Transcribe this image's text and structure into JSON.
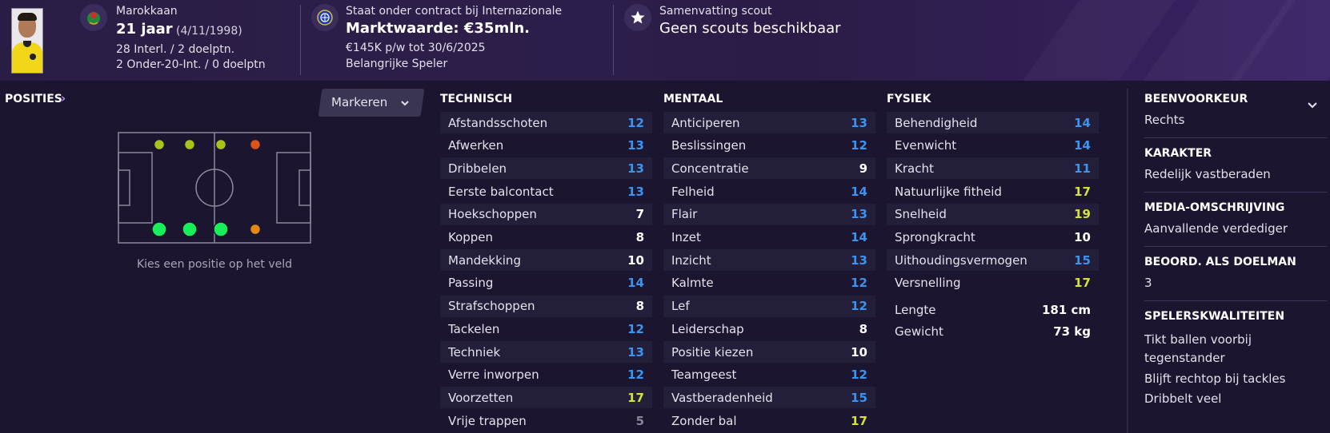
{
  "header": {
    "nationality": "Marokkaan",
    "age": "21 jaar",
    "birthdate": "(4/11/1998)",
    "caps_line": "28 Interl. / 2 doelptn.",
    "u20_line": "2 Onder-20-Int. / 0 doelptn",
    "contract_line": "Staat onder contract bij Internazionale",
    "value": "Marktwaarde: €35mln.",
    "wage_line": "€145K p/w tot 30/6/2025",
    "status": "Belangrijke Speler",
    "scout_title": "Samenvatting scout",
    "scout_value": "Geen scouts beschikbaar",
    "icons": [
      "player-photo",
      "morocco-flag-icon",
      "inter-club-icon",
      "star-icon"
    ]
  },
  "positions": {
    "title": "POSITIES",
    "chevron": "›",
    "mark_button": "Markeren",
    "caption": "Kies een positie op het veld",
    "dots": [
      {
        "row": "top",
        "col": 0,
        "color": "#a8c41c",
        "size": "small"
      },
      {
        "row": "top",
        "col": 1,
        "color": "#a8c41c",
        "size": "small"
      },
      {
        "row": "top",
        "col": 2,
        "color": "#a8c41c",
        "size": "small"
      },
      {
        "row": "top",
        "col": 3,
        "color": "#d8541a",
        "size": "small"
      },
      {
        "row": "bottom",
        "col": 0,
        "color": "#17f05a",
        "size": "large"
      },
      {
        "row": "bottom",
        "col": 1,
        "color": "#17f05a",
        "size": "large"
      },
      {
        "row": "bottom",
        "col": 2,
        "color": "#17f05a",
        "size": "large"
      },
      {
        "row": "bottom",
        "col": 3,
        "color": "#e48a14",
        "size": "small"
      }
    ]
  },
  "columns": [
    {
      "title": "TECHNISCH",
      "attrs": [
        {
          "name": "Afstandsschoten",
          "value": "12",
          "tone": "blue"
        },
        {
          "name": "Afwerken",
          "value": "13",
          "tone": "blue"
        },
        {
          "name": "Dribbelen",
          "value": "13",
          "tone": "blue"
        },
        {
          "name": "Eerste balcontact",
          "value": "13",
          "tone": "blue"
        },
        {
          "name": "Hoekschoppen",
          "value": "7",
          "tone": "white"
        },
        {
          "name": "Koppen",
          "value": "8",
          "tone": "white"
        },
        {
          "name": "Mandekking",
          "value": "10",
          "tone": "white"
        },
        {
          "name": "Passing",
          "value": "14",
          "tone": "blue"
        },
        {
          "name": "Strafschoppen",
          "value": "8",
          "tone": "white"
        },
        {
          "name": "Tackelen",
          "value": "12",
          "tone": "blue"
        },
        {
          "name": "Techniek",
          "value": "13",
          "tone": "blue"
        },
        {
          "name": "Verre inworpen",
          "value": "12",
          "tone": "blue"
        },
        {
          "name": "Voorzetten",
          "value": "17",
          "tone": "yellow"
        },
        {
          "name": "Vrije trappen",
          "value": "5",
          "tone": "grey"
        }
      ]
    },
    {
      "title": "MENTAAL",
      "attrs": [
        {
          "name": "Anticiperen",
          "value": "13",
          "tone": "blue"
        },
        {
          "name": "Beslissingen",
          "value": "12",
          "tone": "blue"
        },
        {
          "name": "Concentratie",
          "value": "9",
          "tone": "white"
        },
        {
          "name": "Felheid",
          "value": "14",
          "tone": "blue"
        },
        {
          "name": "Flair",
          "value": "13",
          "tone": "blue"
        },
        {
          "name": "Inzet",
          "value": "14",
          "tone": "blue"
        },
        {
          "name": "Inzicht",
          "value": "13",
          "tone": "blue"
        },
        {
          "name": "Kalmte",
          "value": "12",
          "tone": "blue"
        },
        {
          "name": "Lef",
          "value": "12",
          "tone": "blue"
        },
        {
          "name": "Leiderschap",
          "value": "8",
          "tone": "white"
        },
        {
          "name": "Positie kiezen",
          "value": "10",
          "tone": "white"
        },
        {
          "name": "Teamgeest",
          "value": "12",
          "tone": "blue"
        },
        {
          "name": "Vastberadenheid",
          "value": "15",
          "tone": "blue"
        },
        {
          "name": "Zonder bal",
          "value": "17",
          "tone": "yellow"
        }
      ]
    },
    {
      "title": "FYSIEK",
      "attrs": [
        {
          "name": "Behendigheid",
          "value": "14",
          "tone": "blue"
        },
        {
          "name": "Evenwicht",
          "value": "14",
          "tone": "blue"
        },
        {
          "name": "Kracht",
          "value": "11",
          "tone": "blue"
        },
        {
          "name": "Natuurlijke fitheid",
          "value": "17",
          "tone": "yellow"
        },
        {
          "name": "Snelheid",
          "value": "19",
          "tone": "yellow"
        },
        {
          "name": "Sprongkracht",
          "value": "10",
          "tone": "white"
        },
        {
          "name": "Uithoudingsvermogen",
          "value": "15",
          "tone": "blue"
        },
        {
          "name": "Versnelling",
          "value": "17",
          "tone": "yellow"
        }
      ],
      "measurements": [
        {
          "name": "Lengte",
          "value": "181 cm"
        },
        {
          "name": "Gewicht",
          "value": "73 kg"
        }
      ]
    }
  ],
  "side": {
    "foot_title": "BEENVOORKEUR",
    "foot_value": "Rechts",
    "character_title": "KARAKTER",
    "character_value": "Redelijk vastberaden",
    "media_title": "MEDIA-OMSCHRIJVING",
    "media_value": "Aanvallende verdediger",
    "gk_title": "BEOORD. ALS DOELMAN",
    "gk_value": "3",
    "traits_title": "SPELERSKWALITEITEN",
    "traits": [
      "Tikt ballen voorbij tegenstander",
      "Blijft rechtop bij tackles",
      "Dribbelt veel"
    ]
  }
}
